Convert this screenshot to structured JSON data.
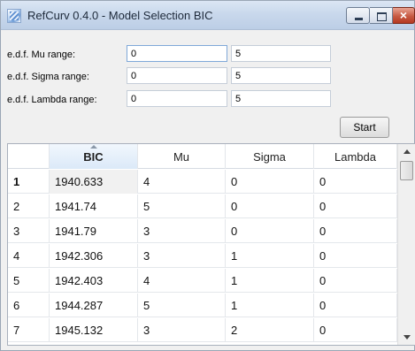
{
  "window": {
    "title": "RefCurv 0.4.0 - Model Selection BIC",
    "icon": "app-icon",
    "controls": {
      "minimize": "minimize-icon",
      "maximize": "maximize-icon",
      "close": "×"
    }
  },
  "form": {
    "mu": {
      "label": "e.d.f. Mu range:",
      "from": "0",
      "to": "5"
    },
    "sigma": {
      "label": "e.d.f. Sigma range:",
      "from": "0",
      "to": "5"
    },
    "lambda": {
      "label": "e.d.f. Lambda range:",
      "from": "0",
      "to": "5"
    },
    "start_label": "Start"
  },
  "table": {
    "columns": [
      "BIC",
      "Mu",
      "Sigma",
      "Lambda"
    ],
    "sorted_column": "BIC",
    "rows": [
      {
        "n": "1",
        "bic": "1940.633",
        "mu": "4",
        "sigma": "0",
        "lambda": "0"
      },
      {
        "n": "2",
        "bic": "1941.74",
        "mu": "5",
        "sigma": "0",
        "lambda": "0"
      },
      {
        "n": "3",
        "bic": "1941.79",
        "mu": "3",
        "sigma": "0",
        "lambda": "0"
      },
      {
        "n": "4",
        "bic": "1942.306",
        "mu": "3",
        "sigma": "1",
        "lambda": "0"
      },
      {
        "n": "5",
        "bic": "1942.403",
        "mu": "4",
        "sigma": "1",
        "lambda": "0"
      },
      {
        "n": "6",
        "bic": "1944.287",
        "mu": "5",
        "sigma": "1",
        "lambda": "0"
      },
      {
        "n": "7",
        "bic": "1945.132",
        "mu": "3",
        "sigma": "2",
        "lambda": "0"
      }
    ]
  },
  "colors": {
    "titlebar": "#c9d8ec",
    "close_button": "#c75a43",
    "sorted_header": "#dbe9f8"
  }
}
